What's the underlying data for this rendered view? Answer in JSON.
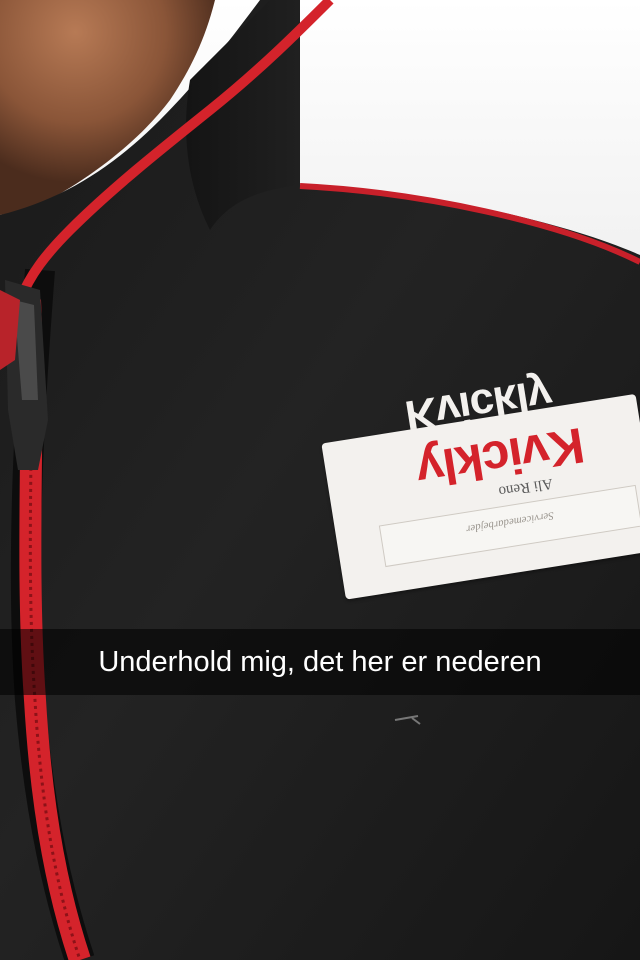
{
  "snap": {
    "caption": "Underhold mig, det her er nederen"
  },
  "badge": {
    "logo_text": "Kvickly",
    "name": "Ali Reno",
    "role": "Servicemedarbejder"
  },
  "colors": {
    "jacket": "#1f1f1f",
    "zipper_red": "#d4232b",
    "badge_white": "#f3f1ee",
    "caption_bar": "rgba(0,0,0,0.55)"
  }
}
